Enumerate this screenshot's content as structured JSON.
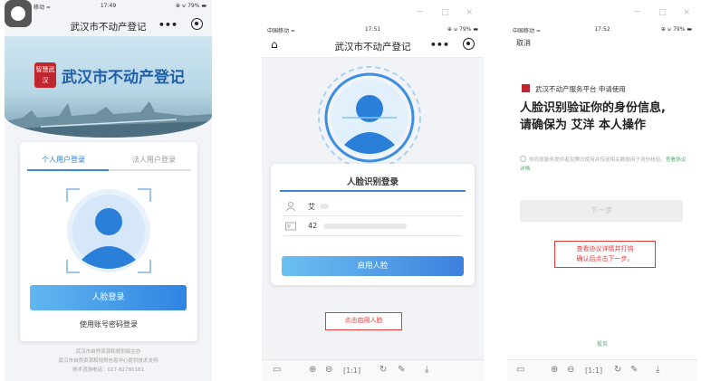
{
  "phone1": {
    "status": {
      "carrier": "移动 ≈",
      "time": "17:49",
      "right": "⊕ ⊍ 79% ▬"
    },
    "nav_title": "武汉市不动产登记",
    "banner": {
      "seal_text": "智慧武汉",
      "title": "武汉市不动产登记"
    },
    "tabs": {
      "personal": "个人用户登录",
      "corporate": "法人用户登录"
    },
    "face_login_button": "人脸登录",
    "account_login_link": "使用账号密码登录",
    "footer": [
      "武汉市自然资源和规划局主办",
      "武汉市自然资源和规划信息中心提供技术支持",
      "技术咨询电话：027-82780181"
    ]
  },
  "phone2": {
    "status": {
      "carrier": "中国移动 ≈",
      "time": "17:51",
      "right": "⊕ ⊍ 79% ▬"
    },
    "window_controls": "－ □ ×",
    "nav_title": "武汉市不动产登记",
    "card_title": "人脸识别登录",
    "name_value": "艾",
    "id_value": "42",
    "enable_button": "启用人脸",
    "hint": "点击启用人脸"
  },
  "phone3": {
    "status": {
      "carrier": "中国移动 ≈",
      "time": "17:52",
      "right": "⊕ ⊍ 79% ▬"
    },
    "window_controls": "－ □ ×",
    "cancel": "取消",
    "platform_line": "武汉不动产服务平台 申请使用",
    "heading_line1": "人脸识别验证你的身份信息,",
    "heading_line2": "请确保为 艾洋 本人操作",
    "agreement_text": "你同意服务提供者及腾讯使用并传送相关数据用于身份核验。",
    "agreement_link": "查看协议详情",
    "next_button": "下一步",
    "hint_line1": "查看协议详情并打钩",
    "hint_line2": "确认后点击下一步。",
    "complaint": "投诉"
  },
  "toolbar_icons": [
    "window-icon",
    "zoom-in-icon",
    "zoom-out-icon",
    "fit-icon",
    "rotate-icon",
    "pen-icon",
    "download-icon"
  ],
  "colors": {
    "accent_blue": "#2f84e2",
    "hint_red": "#e23a3a",
    "link_green": "#4aa86a",
    "seal_red": "#c0262d"
  }
}
